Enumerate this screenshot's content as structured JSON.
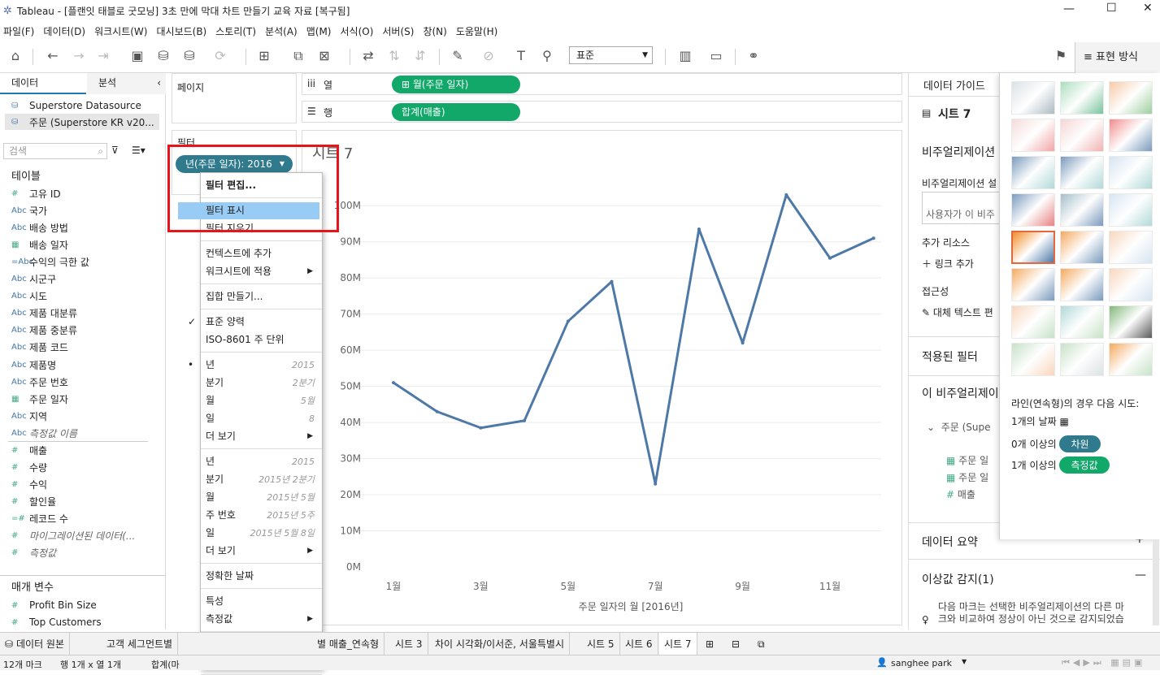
{
  "window": {
    "title": "Tableau - [플랜잇 태블로 굿모닝] 3초 만에 막대 차트 만들기 교육 자료 [복구됨]"
  },
  "menu": [
    "파일(F)",
    "데이터(D)",
    "워크시트(W)",
    "대시보드(B)",
    "스토리(T)",
    "분석(A)",
    "맵(M)",
    "서식(O)",
    "서버(S)",
    "창(N)",
    "도움말(H)"
  ],
  "toolbar": {
    "fit_value": "표준",
    "showme_label": "표현 방식"
  },
  "data_pane": {
    "tab_data": "데이터",
    "tab_analysis": "분석",
    "sources": [
      "Superstore Datasource",
      "주문 (Superstore KR v20..."
    ],
    "search_placeholder": "검색",
    "tables_header": "테이블",
    "fields": [
      {
        "icon": "#",
        "name": "고유 ID"
      },
      {
        "icon": "Abc",
        "name": "국가"
      },
      {
        "icon": "Abc",
        "name": "배송 방법"
      },
      {
        "icon": "cal",
        "name": "배송 일자"
      },
      {
        "icon": "=Abc",
        "name": "수익의 극한 값"
      },
      {
        "icon": "Abc",
        "name": "시군구"
      },
      {
        "icon": "Abc",
        "name": "시도"
      },
      {
        "icon": "Abc",
        "name": "제품 대분류"
      },
      {
        "icon": "Abc",
        "name": "제품 중분류"
      },
      {
        "icon": "Abc",
        "name": "제품 코드"
      },
      {
        "icon": "Abc",
        "name": "제품명"
      },
      {
        "icon": "Abc",
        "name": "주문 번호"
      },
      {
        "icon": "cal",
        "name": "주문 일자"
      },
      {
        "icon": "Abc",
        "name": "지역"
      },
      {
        "icon": "Abc",
        "name": "측정값 이름",
        "italic": true
      }
    ],
    "measures": [
      {
        "icon": "#",
        "name": "매출"
      },
      {
        "icon": "#",
        "name": "수량"
      },
      {
        "icon": "#",
        "name": "수익"
      },
      {
        "icon": "#",
        "name": "할인율"
      },
      {
        "icon": "=#",
        "name": "레코드 수"
      },
      {
        "icon": "#",
        "name": "마이그레이션된 데이터(...",
        "italic": true
      },
      {
        "icon": "#",
        "name": "측정값",
        "italic": true
      }
    ],
    "params_header": "매개 변수",
    "params": [
      "Profit Bin Size",
      "Top Customers"
    ]
  },
  "shelves": {
    "pages": "페이지",
    "filters": "필터",
    "columns_label": "열",
    "rows_label": "행",
    "columns_pill": "월(주문 일자)",
    "rows_pill": "합계(매출)",
    "filter_pill": "년(주문 일자): 2016"
  },
  "context_menu": {
    "items": [
      {
        "label": "필터 편집...",
        "bold": true
      },
      {
        "label": "필터 표시",
        "highlight": true
      },
      {
        "label": "필터 지우기"
      },
      {
        "label": "컨텍스트에 추가"
      },
      {
        "label": "워크시트에 적용",
        "submenu": true
      },
      {
        "label": "집합 만들기..."
      },
      {
        "label": "표준 양력",
        "check": true
      },
      {
        "label": "ISO-8601 주 단위"
      },
      {
        "label": "년",
        "hint": "2015",
        "dot": true
      },
      {
        "label": "분기",
        "hint": "2분기"
      },
      {
        "label": "월",
        "hint": "5월"
      },
      {
        "label": "일",
        "hint": "8"
      },
      {
        "label": "더 보기",
        "submenu": true
      },
      {
        "label": "년",
        "hint": "2015"
      },
      {
        "label": "분기",
        "hint": "2015년 2분기"
      },
      {
        "label": "월",
        "hint": "2015년 5월"
      },
      {
        "label": "주 번호",
        "hint": "2015년 5주"
      },
      {
        "label": "일",
        "hint": "2015년 5월 8일"
      },
      {
        "label": "더 보기",
        "submenu": true
      },
      {
        "label": "정확한 날짜"
      },
      {
        "label": "특성"
      },
      {
        "label": "측정값",
        "submenu": true
      },
      {
        "label": "불연속형",
        "dot": true
      },
      {
        "label": "연속형"
      }
    ]
  },
  "sheet": {
    "title": "시트 7"
  },
  "chart_data": {
    "type": "line",
    "title": "",
    "xlabel": "주문 일자의 월 [2016년]",
    "ylabel": "",
    "categories": [
      "1월",
      "2월",
      "3월",
      "4월",
      "5월",
      "6월",
      "7월",
      "8월",
      "9월",
      "10월",
      "11월",
      "12월"
    ],
    "tick_labels_x": [
      "1월",
      "3월",
      "5월",
      "7월",
      "9월",
      "11월"
    ],
    "values": [
      51,
      43,
      38.5,
      40.5,
      68,
      79,
      23,
      93.5,
      62,
      103,
      85.5,
      91
    ],
    "y_tick_labels": [
      "0M",
      "10M",
      "20M",
      "30M",
      "40M",
      "50M",
      "60M",
      "70M",
      "80M",
      "90M",
      "100M"
    ],
    "ylim": [
      0,
      105
    ],
    "unit": "M",
    "color": "#4e79a7",
    "grid": true
  },
  "data_guide": {
    "header": "데이터 가이드",
    "sheet": "시트 7",
    "viz_section": "비주얼리제이션",
    "viz_desc_label": "비주얼리제이션 설",
    "viz_desc_placeholder": "사용자가 이 비주\n이 되는 설명을 입",
    "resources": "추가 리소스",
    "add_link": "링크 추가",
    "accessibility": "접근성",
    "alt_text": "대체 텍스트 편",
    "applied_filters": "적용된 필터",
    "this_viz": "이 비주얼리제이",
    "source": "주문 (Supe",
    "source_fields": [
      "주문 일",
      "주문 일",
      "매출"
    ],
    "data_summary": "데이터 요약",
    "outlier": "이상값 감지(1)",
    "outlier_desc": "다음 마크는 선택한 비주얼리제이션의 다른 마\n크와 비교하여 정상이 아닌 것으로 감지되었습"
  },
  "show_me": {
    "hint": "라인(연속형)의 경우 다음 시도:",
    "req1": "1개의 날짜",
    "req2_prefix": "0개 이상의",
    "req2_pill": "차원",
    "req3_prefix": "1개 이상의",
    "req3_pill": "측정값"
  },
  "tabs": [
    "데이터 원본",
    "고객 세그먼트별",
    "별 매출_연속형",
    "시트 3",
    "차이 시각화/이서준, 서울특별시",
    "시트 5",
    "시트 6",
    "시트 7"
  ],
  "status": {
    "marks": "12개 마크",
    "rows_cols": "행 1개  x  열 1개",
    "sum": "합계(마",
    "user": "sanghee park"
  }
}
